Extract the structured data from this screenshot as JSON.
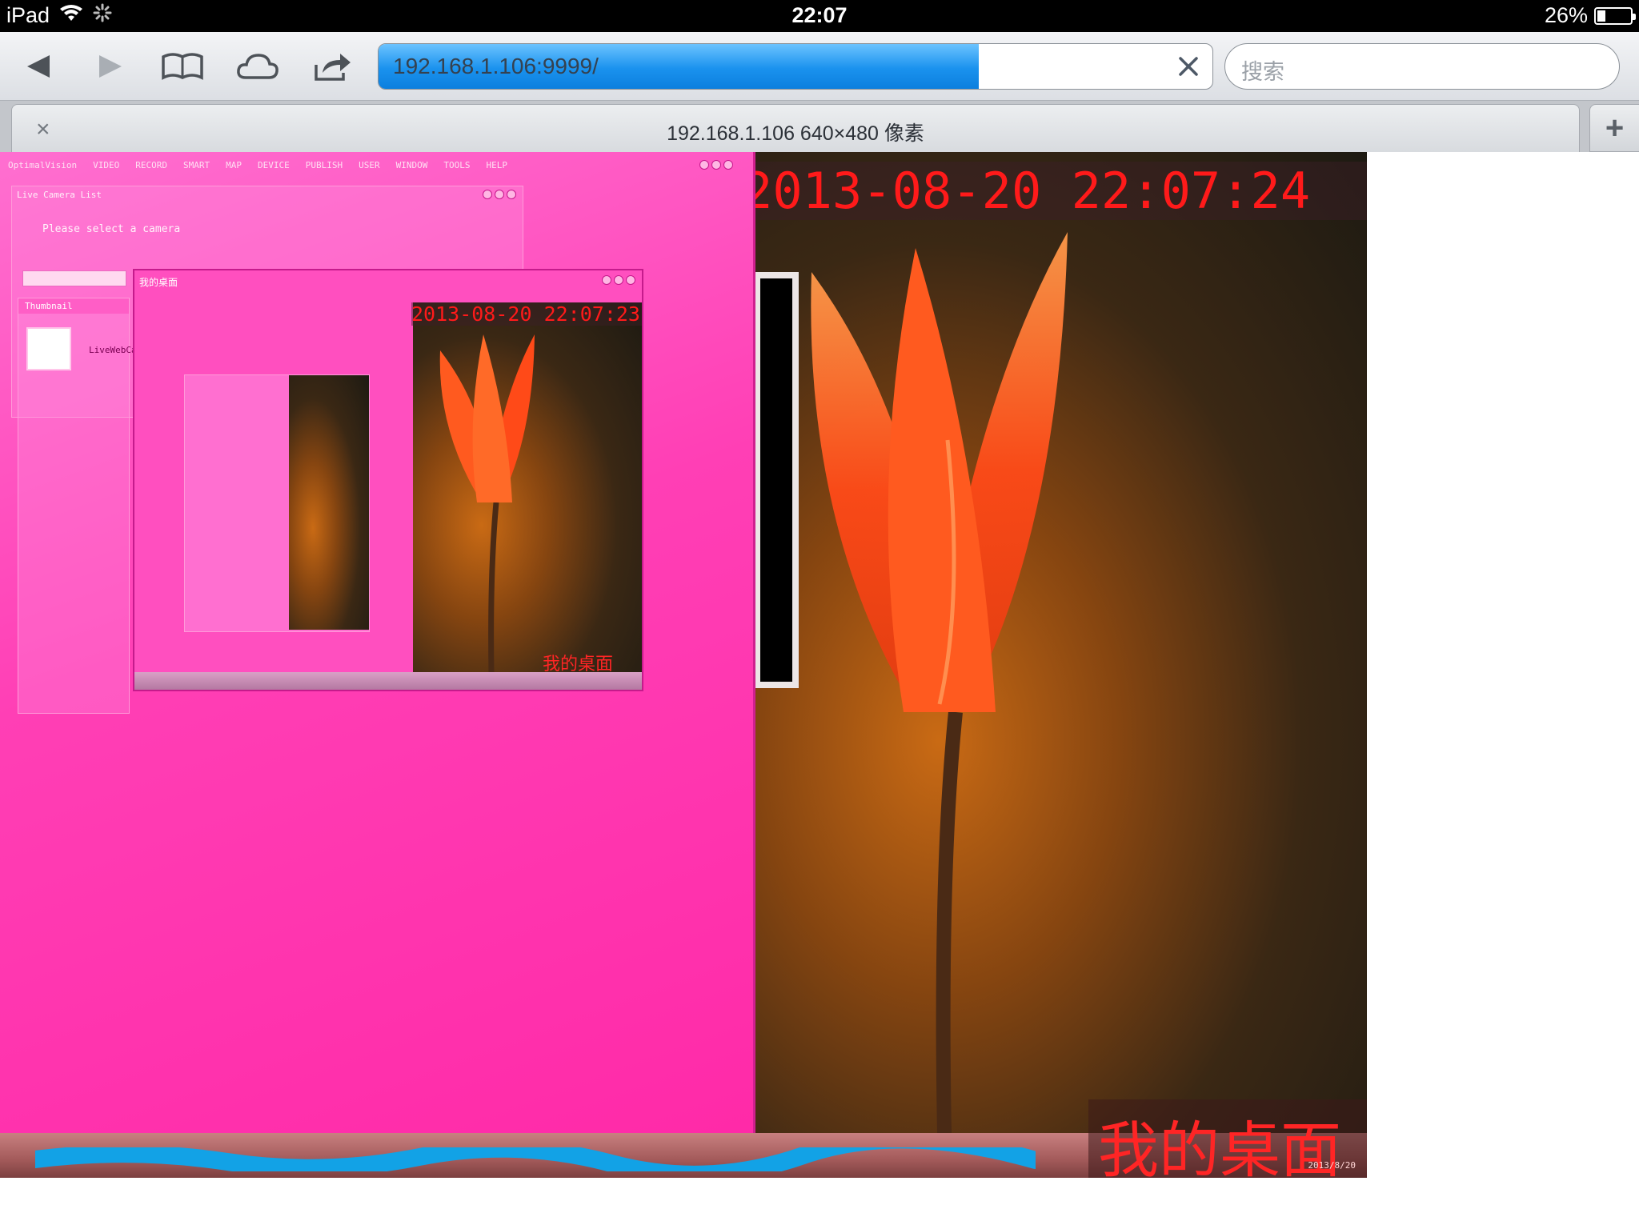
{
  "status_bar": {
    "device": "iPad",
    "time": "22:07",
    "battery_percent": "26%",
    "battery_level": 0.26
  },
  "toolbar": {
    "url": "192.168.1.106:9999/",
    "load_progress": 0.72,
    "search_placeholder": "搜索",
    "icons": [
      "back-icon",
      "forward-icon",
      "bookmarks-icon",
      "icloud-tabs-icon",
      "share-icon",
      "clear-icon"
    ]
  },
  "tab": {
    "close_label": "×",
    "title": "192.168.1.106 640×480 像素",
    "new_tab_label": "+"
  },
  "remote_desktop": {
    "menu_items": [
      "OptimalVision",
      "VIDEO",
      "RECORD",
      "SMART",
      "MAP",
      "DEVICE",
      "PUBLISH",
      "USER",
      "WINDOW",
      "TOOLS",
      "HELP"
    ],
    "panel_title": "Live Camera List",
    "panel_message": "Please select a camera",
    "thumbnail_header": "Thumbnail",
    "thumbnail_label": "LiveWebCam",
    "nested_window_title": "我的桌面",
    "main_timestamp": "2013-08-20 22:07:24",
    "nested_timestamp": "2013-08-20 22:07:23",
    "main_caption": "我的桌面",
    "nested_caption": "我的桌面",
    "tray_date": "2013/8/20"
  }
}
